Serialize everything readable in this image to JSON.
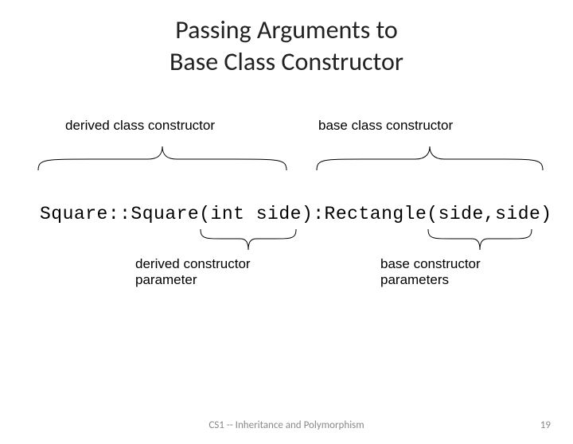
{
  "title_line1": "Passing Arguments to",
  "title_line2": "Base Class Constructor",
  "labels": {
    "derived_class_constructor": "derived class constructor",
    "base_class_constructor": "base class constructor",
    "derived_constructor_parameter": "derived constructor\nparameter",
    "base_constructor_parameters": "base constructor\nparameters"
  },
  "code": "Square::Square(int side):Rectangle(side,side)",
  "footer": "CS1 -- Inheritance and Polymorphism",
  "page_number": "19"
}
